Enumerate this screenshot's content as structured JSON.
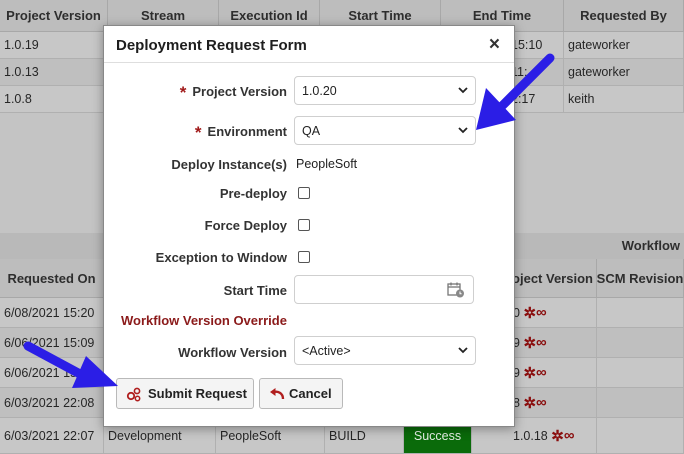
{
  "background": {
    "top_headers": [
      "Project Version",
      "Stream",
      "Execution Id",
      "Start Time",
      "End Time",
      "Requested By"
    ],
    "top_rows": [
      {
        "project_version": "1.0.19",
        "end_time": "15:10",
        "requested_by": "gateworker"
      },
      {
        "project_version": "1.0.13",
        "end_time": "11:",
        "requested_by": "gateworker"
      },
      {
        "project_version": "1.0.8",
        "end_time": "2:17",
        "requested_by": "keith"
      }
    ],
    "workflow_label": "Workflow",
    "bottom_headers": [
      "Requested On",
      "oject Version",
      "SCM Revision"
    ],
    "bottom_rows": [
      {
        "requested_on": "6/08/2021 15:20",
        "version": "0"
      },
      {
        "requested_on": "6/06/2021 15:09",
        "version": "9"
      },
      {
        "requested_on": "6/06/2021 15:0",
        "version": "9"
      },
      {
        "requested_on": "6/03/2021 22:08",
        "version": "8"
      },
      {
        "requested_on": "6/03/2021 22:07",
        "stream": "Development",
        "app": "PeopleSoft",
        "type": "BUILD",
        "status": "Success",
        "version": "1.0.18"
      }
    ]
  },
  "modal": {
    "title": "Deployment Request Form",
    "close": "×",
    "project_version_label": "Project Version",
    "project_version_value": "1.0.20",
    "environment_label": "Environment",
    "environment_value": "QA",
    "deploy_instance_label": "Deploy Instance(s)",
    "deploy_instance_value": "PeopleSoft",
    "pre_deploy_label": "Pre-deploy",
    "force_deploy_label": "Force Deploy",
    "exception_label": "Exception to Window",
    "start_time_label": "Start Time",
    "start_time_value": "",
    "override_section": "Workflow Version Override",
    "workflow_version_label": "Workflow Version",
    "workflow_version_value": "<Active>",
    "required_mark": "*",
    "submit_label": "Submit Request",
    "cancel_label": "Cancel"
  },
  "colors": {
    "required": "#a01818",
    "section": "#8b1a1a",
    "success": "#0a6b0a",
    "arrow": "#2b1ee6"
  }
}
